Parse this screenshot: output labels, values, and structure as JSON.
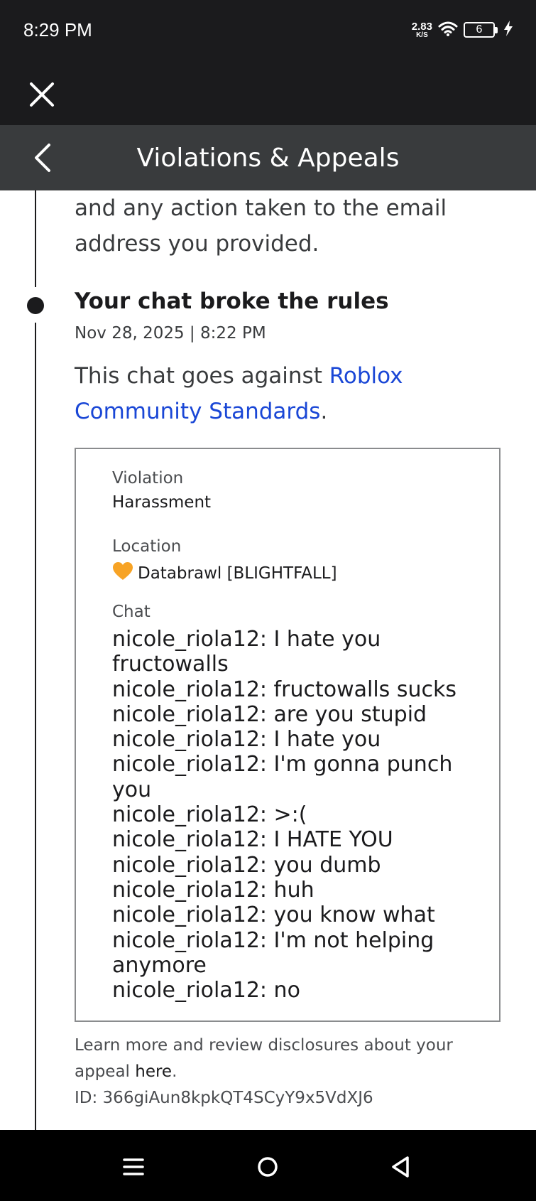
{
  "status_bar": {
    "time": "8:29 PM",
    "net_speed_value": "2.83",
    "net_speed_unit": "K/S",
    "battery_level": "6",
    "icons": [
      "wifi-icon",
      "battery-icon",
      "charging-bolt-icon"
    ]
  },
  "web_top": {
    "close_icon": "close-icon"
  },
  "header": {
    "back_icon": "chevron-left-icon",
    "title": "Violations & Appeals"
  },
  "previous_event": {
    "text_line1": "and any action taken to the email",
    "text_line2": "address you provided."
  },
  "event": {
    "title": "Your chat broke the rules",
    "date": "Nov 28, 2025 | 8:22 PM",
    "description_prefix": "This chat goes against ",
    "link_line1": "Roblox",
    "link_line2": "Community Standards",
    "description_suffix": "."
  },
  "details": {
    "violation_label": "Violation",
    "violation_value": "Harassment",
    "location_label": "Location",
    "location_icon": "orange-heart-icon",
    "location_value": "Databrawl [BLIGHTFALL]",
    "chat_label": "Chat",
    "chat_lines": [
      "nicole_riola12: I hate you",
      "fructowalls",
      "nicole_riola12: fructowalls sucks",
      "nicole_riola12: are you stupid",
      "nicole_riola12: I hate you",
      "nicole_riola12: I'm gonna punch",
      "you",
      "nicole_riola12: >:(",
      "nicole_riola12: I HATE YOU",
      "nicole_riola12: you dumb",
      "nicole_riola12: huh",
      "nicole_riola12: you know what",
      "nicole_riola12: I'm not helping",
      "anymore",
      "nicole_riola12: no"
    ]
  },
  "footer": {
    "learn_more_line1": "Learn more and review disclosures about your",
    "learn_more_line2_prefix": "appeal ",
    "here_link": "here",
    "learn_more_line2_suffix": ".",
    "id_text": "ID: 366giAun8kpkQT4SCyY9x5VdXJ6"
  },
  "system_nav": {
    "icons": [
      "menu-icon",
      "home-circle-icon",
      "back-triangle-icon"
    ]
  },
  "colors": {
    "status_bg": "#1b1b1d",
    "header_bg": "#393b3d",
    "link": "#1a47d6",
    "text": "#393b3d",
    "heart": "#f7a325"
  }
}
